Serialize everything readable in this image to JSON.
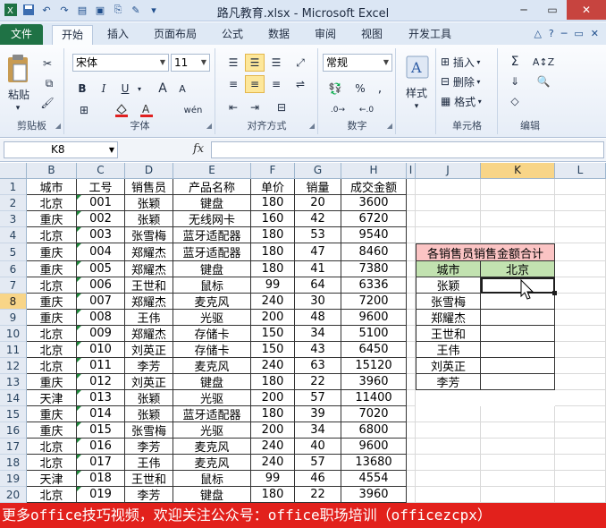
{
  "window": {
    "title": "路凡教育.xlsx  -  Microsoft Excel"
  },
  "tabs": [
    "文件",
    "开始",
    "插入",
    "页面布局",
    "公式",
    "数据",
    "审阅",
    "视图",
    "开发工具"
  ],
  "ribbon": {
    "clipboard": {
      "paste_label": "粘贴",
      "group_label": "剪贴板"
    },
    "font": {
      "name": "宋体",
      "size": "11",
      "group_label": "字体",
      "bold": "B",
      "italic": "I",
      "underline": "U",
      "grow": "A",
      "shrink": "A",
      "wen": "wén"
    },
    "alignment": {
      "group_label": "对齐方式"
    },
    "number": {
      "format": "常规",
      "group_label": "数字",
      "percent": "%",
      "comma": ","
    },
    "styles": {
      "label": "样式"
    },
    "cells": {
      "insert": "插入",
      "delete": "删除",
      "format": "格式",
      "group_label": "单元格"
    },
    "editing": {
      "sum": "Σ",
      "group_label": "编辑"
    }
  },
  "formula_bar": {
    "name_box": "K8",
    "fx": "fx",
    "formula": ""
  },
  "columns": [
    "B",
    "C",
    "D",
    "E",
    "F",
    "G",
    "H",
    "I",
    "J",
    "K",
    "L"
  ],
  "selected_column": "K",
  "selected_row": "8",
  "rows": [
    "1",
    "2",
    "3",
    "4",
    "5",
    "6",
    "7",
    "8",
    "9",
    "10",
    "11",
    "12",
    "13",
    "14",
    "15",
    "16",
    "17",
    "18",
    "19",
    "20"
  ],
  "table": {
    "headers": [
      "城市",
      "工号",
      "销售员",
      "产品名称",
      "单价",
      "销量",
      "成交金额"
    ],
    "data": [
      [
        "北京",
        "001",
        "张颖",
        "键盘",
        "180",
        "20",
        "3600"
      ],
      [
        "重庆",
        "002",
        "张颖",
        "无线网卡",
        "160",
        "42",
        "6720"
      ],
      [
        "北京",
        "003",
        "张雪梅",
        "蓝牙适配器",
        "180",
        "53",
        "9540"
      ],
      [
        "重庆",
        "004",
        "郑耀杰",
        "蓝牙适配器",
        "180",
        "47",
        "8460"
      ],
      [
        "重庆",
        "005",
        "郑耀杰",
        "键盘",
        "180",
        "41",
        "7380"
      ],
      [
        "北京",
        "006",
        "王世和",
        "鼠标",
        "99",
        "64",
        "6336"
      ],
      [
        "重庆",
        "007",
        "郑耀杰",
        "麦克风",
        "240",
        "30",
        "7200"
      ],
      [
        "重庆",
        "008",
        "王伟",
        "光驱",
        "200",
        "48",
        "9600"
      ],
      [
        "北京",
        "009",
        "郑耀杰",
        "存储卡",
        "150",
        "34",
        "5100"
      ],
      [
        "北京",
        "010",
        "刘英正",
        "存储卡",
        "150",
        "43",
        "6450"
      ],
      [
        "北京",
        "011",
        "李芳",
        "麦克风",
        "240",
        "63",
        "15120"
      ],
      [
        "重庆",
        "012",
        "刘英正",
        "键盘",
        "180",
        "22",
        "3960"
      ],
      [
        "天津",
        "013",
        "张颖",
        "光驱",
        "200",
        "57",
        "11400"
      ],
      [
        "重庆",
        "014",
        "张颖",
        "蓝牙适配器",
        "180",
        "39",
        "7020"
      ],
      [
        "重庆",
        "015",
        "张雪梅",
        "光驱",
        "200",
        "34",
        "6800"
      ],
      [
        "北京",
        "016",
        "李芳",
        "麦克风",
        "240",
        "40",
        "9600"
      ],
      [
        "北京",
        "017",
        "王伟",
        "麦克风",
        "240",
        "57",
        "13680"
      ],
      [
        "天津",
        "018",
        "王世和",
        "鼠标",
        "99",
        "46",
        "4554"
      ],
      [
        "北京",
        "019",
        "李芳",
        "键盘",
        "180",
        "22",
        "3960"
      ]
    ]
  },
  "summary": {
    "title": "各销售员销售金额合计",
    "header_left": "城市",
    "header_right": "北京",
    "names": [
      "张颖",
      "张雪梅",
      "郑耀杰",
      "王世和",
      "王伟",
      "刘英正",
      "李芳"
    ]
  },
  "banner": "更多office技巧视频，欢迎关注公众号：office职场培训（officezcpx）"
}
